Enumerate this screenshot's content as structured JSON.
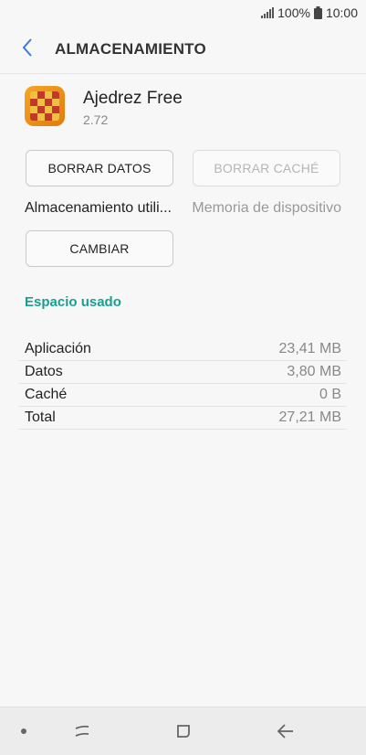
{
  "status_bar": {
    "battery": "100%",
    "time": "10:00"
  },
  "header": {
    "title": "ALMACENAMIENTO"
  },
  "app": {
    "name": "Ajedrez Free",
    "version": "2.72"
  },
  "buttons": {
    "clear_data": "BORRAR DATOS",
    "clear_cache": "BORRAR CACHÉ",
    "change": "CAMBIAR"
  },
  "storage": {
    "label": "Almacenamiento utili...",
    "value": "Memoria de dispositivo"
  },
  "section": {
    "title": "Espacio usado"
  },
  "usage": [
    {
      "label": "Aplicación",
      "value": "23,41 MB"
    },
    {
      "label": "Datos",
      "value": "3,80 MB"
    },
    {
      "label": "Caché",
      "value": "0 B"
    },
    {
      "label": "Total",
      "value": "27,21 MB"
    }
  ],
  "colors": {
    "accent": "#1a9e8f",
    "back_arrow": "#3a7bd5"
  }
}
